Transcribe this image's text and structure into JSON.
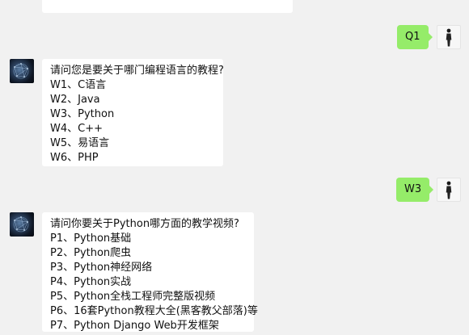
{
  "chat": {
    "messages": [
      {
        "id": "m1",
        "side": "right",
        "text": "Q1"
      },
      {
        "id": "m2",
        "side": "left",
        "lines": [
          "请问您是要关于哪门编程语言的教程?",
          "W1、C语言",
          "W2、Java",
          "W3、Python",
          "W4、C++",
          "W5、易语言",
          "W6、PHP"
        ]
      },
      {
        "id": "m3",
        "side": "right",
        "text": "W3"
      },
      {
        "id": "m4",
        "side": "left",
        "lines": [
          "请问你要关于Python哪方面的教学视频?",
          "P1、Python基础",
          "P2、Python爬虫",
          "P3、Python神经网络",
          "P4、Python实战",
          "P5、Python全栈工程师完整版视频",
          "P6、16套Python教程大全(黑客教父部落)等",
          "P7、Python Django Web开发框架"
        ]
      }
    ]
  },
  "colors": {
    "background": "#f1f1f1",
    "outgoing_bubble": "#95ec69",
    "incoming_bubble": "#ffffff"
  },
  "icons": {
    "bot_avatar": "network-globe-avatar",
    "user_avatar": "person-silhouette-avatar"
  }
}
